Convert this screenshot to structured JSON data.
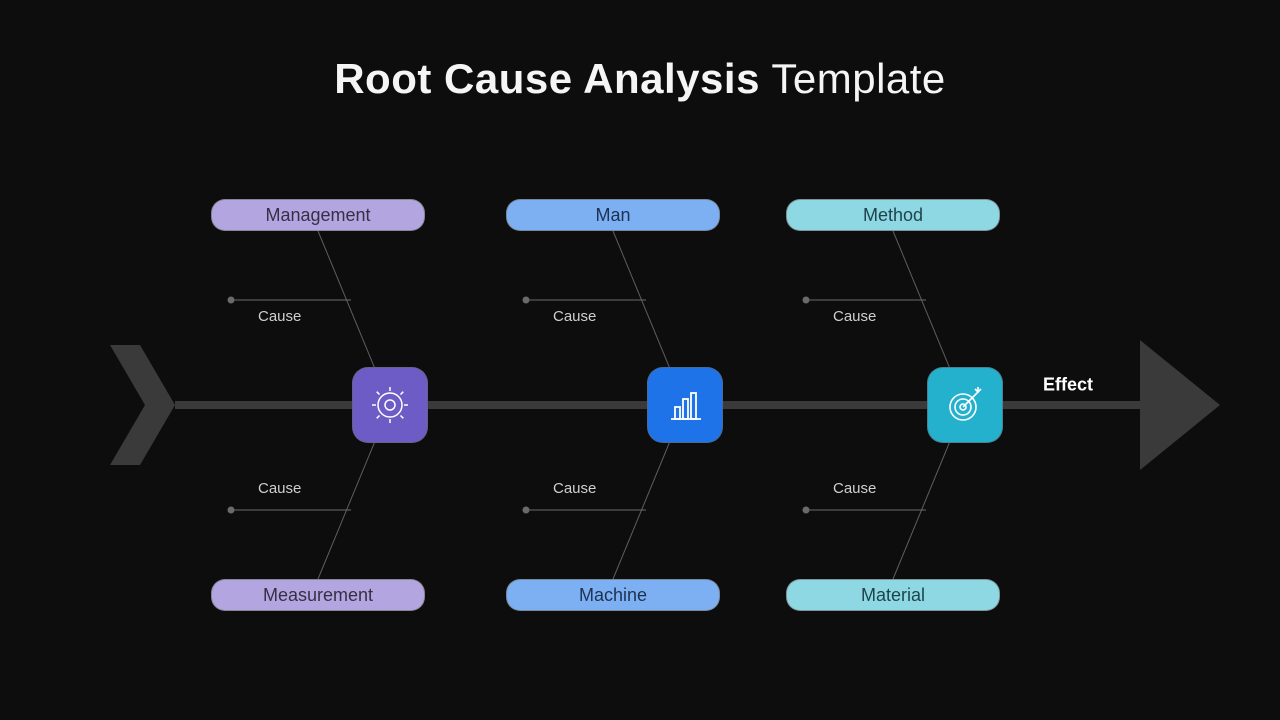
{
  "title": {
    "bold_part": "Root Cause Analysis",
    "light_part": "Template"
  },
  "effect_label": "Effect",
  "nodes": {
    "n1_icon": "gear-icon",
    "n2_icon": "bar-chart-icon",
    "n3_icon": "target-icon"
  },
  "categories": {
    "top": [
      {
        "label": "Management",
        "color": "purple"
      },
      {
        "label": "Man",
        "color": "blue"
      },
      {
        "label": "Method",
        "color": "teal"
      }
    ],
    "bottom": [
      {
        "label": "Measurement",
        "color": "purple"
      },
      {
        "label": "Machine",
        "color": "blue"
      },
      {
        "label": "Material",
        "color": "teal"
      }
    ]
  },
  "cause_label": "Cause"
}
